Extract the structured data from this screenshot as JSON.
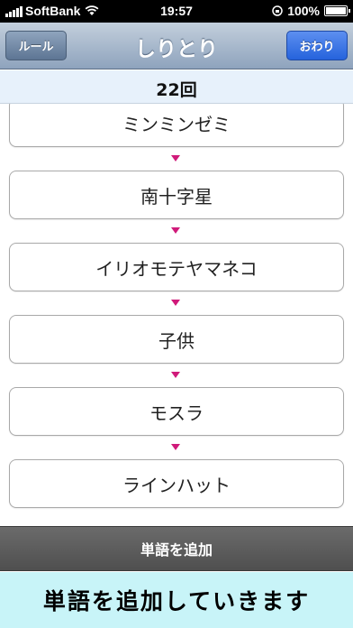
{
  "status_bar": {
    "carrier": "SoftBank",
    "time": "19:57",
    "battery": "100%",
    "battery_level": 1.0
  },
  "nav": {
    "title": "しりとり",
    "rules_button": "ルール",
    "end_button": "おわり"
  },
  "turn_count": "22回",
  "words": [
    "ミンミンゼミ",
    "南十字星",
    "イリオモテヤマネコ",
    "子供",
    "モスラ",
    "ラインハット"
  ],
  "add_button": "単語を追加",
  "banner": "単語を追加していきます",
  "colors": {
    "arrow": "#d01a7a",
    "banner_bg": "#c8f4f8",
    "end_button": "#2563dc"
  }
}
